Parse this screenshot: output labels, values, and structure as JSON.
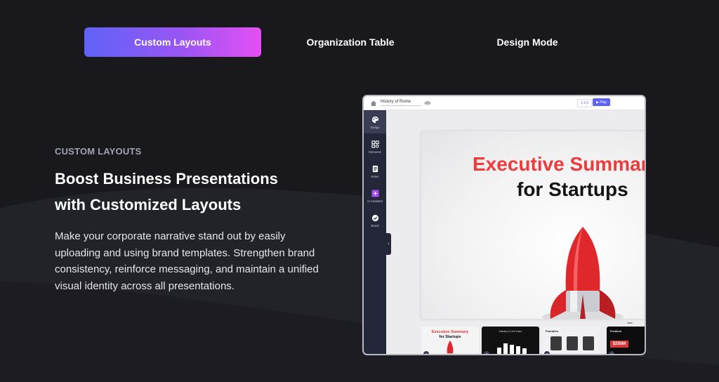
{
  "tabs": [
    {
      "label": "Custom Layouts",
      "active": true
    },
    {
      "label": "Organization Table",
      "active": false
    },
    {
      "label": "Design Mode",
      "active": false
    }
  ],
  "feature": {
    "eyebrow": "CUSTOM LAYOUTS",
    "headline_line1": "Boost Business Presentations",
    "headline_line2": "with Customized Layouts",
    "description": "Make your corporate narrative stand out by easily uploading and using brand templates. Strengthen brand consistency, reinforce messaging, and maintain a unified visual identity across all presentations."
  },
  "app": {
    "doc_title": "History of Rome",
    "zoom_label": "1:1:0",
    "play_label": "▶ Play",
    "sidebar": [
      {
        "label": "Design",
        "icon": "palette-icon",
        "active": true
      },
      {
        "label": "Elements",
        "icon": "grid-icon",
        "active": false
      },
      {
        "label": "Notes",
        "icon": "notes-icon",
        "active": false
      },
      {
        "label": "AI Assistant",
        "icon": "sparkle-icon",
        "active": false
      },
      {
        "label": "Brand",
        "icon": "check-badge-icon",
        "active": false
      }
    ],
    "slide": {
      "title_line1": "Executive Summary",
      "title_line2": "for Startups"
    },
    "thumbnails": [
      {
        "num": "1",
        "title1": "Executive Summary",
        "title2": "for Startups"
      },
      {
        "num": "2",
        "title": "Industry & Unit Years"
      },
      {
        "num": "3",
        "title": "Founders"
      },
      {
        "num": "4",
        "title": "Problem",
        "badge": "$250M"
      }
    ]
  },
  "colors": {
    "background": "#18181d",
    "tab_gradient_start": "#5f63f7",
    "tab_gradient_end": "#e450f3",
    "slide_title_red": "#ee3c3c",
    "sidebar_bg": "#24263a"
  }
}
